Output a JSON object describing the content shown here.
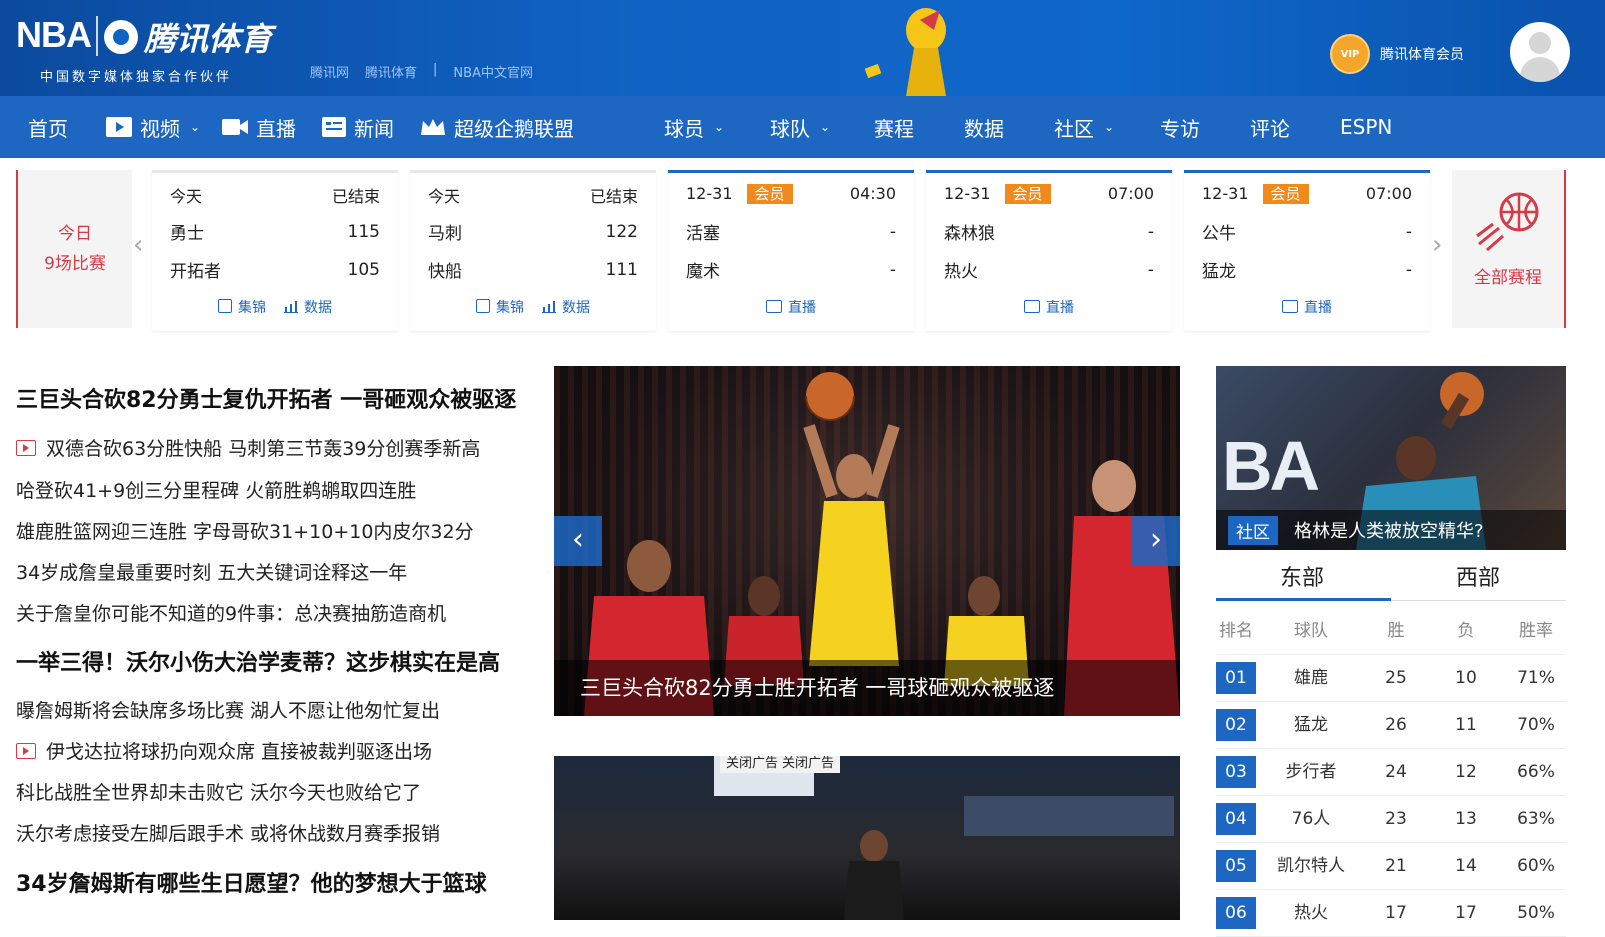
{
  "header": {
    "nba_logo": "NBA",
    "tencent_logo": "腾讯体育",
    "subtitle": "中国数字媒体独家合作伙伴",
    "links": [
      "腾讯网",
      "腾讯体育",
      "|",
      "NBA中文官网"
    ],
    "vip_badge": "VIP",
    "vip_label": "腾讯体育会员"
  },
  "nav": {
    "items": [
      {
        "label": "首页"
      },
      {
        "label": "视频",
        "caret": "⌄"
      },
      {
        "label": "直播"
      },
      {
        "label": "新闻"
      },
      {
        "label": "超级企鹅联盟"
      },
      {
        "label": "球员",
        "caret": "⌄"
      },
      {
        "label": "球队",
        "caret": "⌄"
      },
      {
        "label": "赛程"
      },
      {
        "label": "数据"
      },
      {
        "label": "社区",
        "caret": "⌄"
      },
      {
        "label": "专访"
      },
      {
        "label": "评论"
      },
      {
        "label": "ESPN"
      }
    ]
  },
  "scores": {
    "today_line1": "今日",
    "today_line2": "9场比赛",
    "all_schedule": "全部赛程",
    "games": [
      {
        "date": "今天",
        "status": "已结束",
        "badge": "",
        "team1": "勇士",
        "score1": "115",
        "team2": "开拓者",
        "score2": "105",
        "links": [
          "集锦",
          "数据"
        ]
      },
      {
        "date": "今天",
        "status": "已结束",
        "badge": "",
        "team1": "马刺",
        "score1": "122",
        "team2": "快船",
        "score2": "111",
        "links": [
          "集锦",
          "数据"
        ]
      },
      {
        "date": "12-31",
        "status": "04:30",
        "badge": "会员",
        "team1": "活塞",
        "score1": "-",
        "team2": "魔术",
        "score2": "-",
        "links": [
          "直播"
        ]
      },
      {
        "date": "12-31",
        "status": "07:00",
        "badge": "会员",
        "team1": "森林狼",
        "score1": "-",
        "team2": "热火",
        "score2": "-",
        "links": [
          "直播"
        ]
      },
      {
        "date": "12-31",
        "status": "07:00",
        "badge": "会员",
        "team1": "公牛",
        "score1": "-",
        "team2": "猛龙",
        "score2": "-",
        "links": [
          "直播"
        ]
      }
    ]
  },
  "headlines": {
    "h1": "三巨头合砍82分勇士复仇开拓者 一哥砸观众被驱逐",
    "items1": [
      "双德合砍63分胜快船 马刺第三节轰39分创赛季新高",
      "哈登砍41+9创三分里程碑 火箭胜鹈鹕取四连胜",
      "雄鹿胜篮网迎三连胜 字母哥砍31+10+10内皮尔32分",
      "34岁成詹皇最重要时刻 五大关键词诠释这一年",
      "关于詹皇你可能不知道的9件事：总决赛抽筋造商机"
    ],
    "h2": "一举三得！沃尔小伤大治学麦蒂？这步棋实在是高",
    "items2": [
      "曝詹姆斯将会缺席多场比赛 湖人不愿让他匆忙复出",
      "伊戈达拉将球扔向观众席 直接被裁判驱逐出场",
      "科比战胜全世界却未击败它 沃尔今天也败给它了",
      "沃尔考虑接受左脚后跟手术 或将休战数月赛季报销"
    ],
    "h3": "34岁詹姆斯有哪些生日愿望？他的梦想大于篮球"
  },
  "hero": {
    "caption": "三巨头合砍82分勇士胜开拓者 一哥球砸观众被驱逐",
    "prev": "‹",
    "next": "›"
  },
  "ad": {
    "close1": "关闭广告",
    "close2": "关闭广告"
  },
  "side": {
    "photo_text": "BA",
    "tag": "社区",
    "caption": "格林是人类被放空精华?",
    "tab_east": "东部",
    "tab_west": "西部"
  },
  "standings": {
    "headers": [
      "排名",
      "球队",
      "胜",
      "负",
      "胜率"
    ],
    "rows": [
      {
        "rank": "01",
        "team": "雄鹿",
        "w": "25",
        "l": "10",
        "pct": "71%"
      },
      {
        "rank": "02",
        "team": "猛龙",
        "w": "26",
        "l": "11",
        "pct": "70%"
      },
      {
        "rank": "03",
        "team": "步行者",
        "w": "24",
        "l": "12",
        "pct": "66%"
      },
      {
        "rank": "04",
        "team": "76人",
        "w": "23",
        "l": "13",
        "pct": "63%"
      },
      {
        "rank": "05",
        "team": "凯尔特人",
        "w": "21",
        "l": "14",
        "pct": "60%"
      },
      {
        "rank": "06",
        "team": "热火",
        "w": "17",
        "l": "17",
        "pct": "50%"
      }
    ]
  },
  "colors": {
    "brand_blue": "#1d67c3",
    "accent_red": "#d63a47",
    "vip_orange": "#f08a1c"
  }
}
